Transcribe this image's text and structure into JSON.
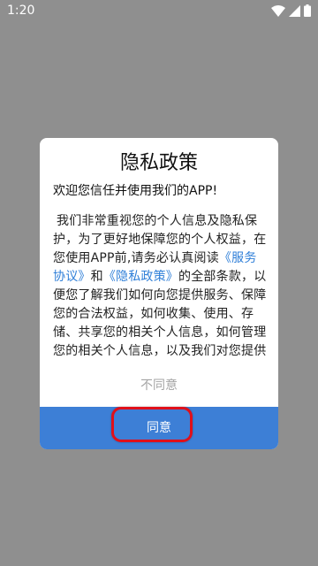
{
  "status_bar": {
    "time": "1:20",
    "icons": [
      "wifi-icon",
      "cellular-signal-icon",
      "battery-icon"
    ]
  },
  "dialog": {
    "title": "隐私政策",
    "welcome": "欢迎您信任并使用我们的APP!",
    "body_part1": "我们非常重视您的个人信息及隐私保护，为了更好地保障您的个人权益，在您使用APP前,请务必认真阅读",
    "link_service": "《服务协议》",
    "body_and": "和",
    "link_privacy": "《隐私政策》",
    "body_part2": "的全部条款，以便您了解我们如何向您提供服务、保障您的合法权益，如何收集、使用、存储、共享您的相关个人信息，如何管理您的相关个人信息，以及我们对您提供",
    "disagree_label": "不同意",
    "agree_label": "同意"
  },
  "colors": {
    "overlay": "#8f8f8f",
    "link": "#2f7fd8",
    "agree_button": "#3d7fd6",
    "highlight": "#e0101a"
  }
}
